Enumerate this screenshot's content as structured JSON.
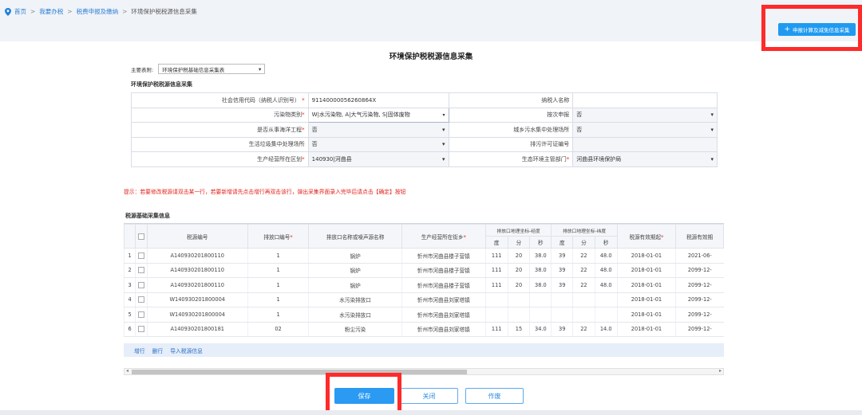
{
  "breadcrumb": {
    "items": [
      "首页",
      "我要办税",
      "税费申报及缴纳",
      "环境保护税税源信息采集"
    ],
    "separator": ">"
  },
  "top_button": {
    "label": "申报计算及减免信息采集",
    "icon": "plus-icon"
  },
  "form": {
    "title": "环境保护税税源信息采集",
    "main_table_label": "主要表附:",
    "main_table_value": "环境保护税基础信息采集表",
    "section_title": "环境保护税税源信息采集",
    "fields": {
      "credit_code_label": "社会信用代码（纳税人识别号）",
      "credit_code_value": "91140000056260864X",
      "taxpayer_name_label": "纳税人名称",
      "taxpayer_name_value": "",
      "pollutant_label": "污染物类别",
      "pollutant_value": "W|水污染物, A|大气污染物, S|固体废物",
      "per_time_label": "按次申报",
      "per_time_value": "否",
      "marine_label": "是否从事海洋工程",
      "marine_value": "否",
      "sewage_label": "城乡污水集中处理场所",
      "sewage_value": "否",
      "garbage_label": "生活垃圾集中处理场所",
      "garbage_value": "否",
      "permit_label": "排污许可证编号",
      "permit_value": "",
      "district_label": "生产经营所在区划",
      "district_value": "140930|河曲县",
      "env_dept_label": "生态环境主管部门",
      "env_dept_value": "河曲县环境保护局"
    }
  },
  "tip": "提示：若要修改税源请双击某一行，若要新增请先点击增行再双击该行，弹出采集界面录入完毕后请点击【确定】按钮",
  "grid": {
    "title": "税源基础采集信息",
    "headers": {
      "source_no": "税源编号",
      "outlet_no": "排放口编号",
      "outlet_name": "排放口名称或噪声源名称",
      "location": "生产经营所在街乡",
      "longitude_group": "排放口地理坐标-经度",
      "latitude_group": "排放口地理坐标-纬度",
      "deg": "度",
      "min": "分",
      "sec": "秒",
      "valid_from": "税源有效期起",
      "valid_to": "税源有效期"
    },
    "rows": [
      {
        "n": "1",
        "source": "A140930201800110",
        "outlet": "1",
        "name": "锅炉",
        "loc": "忻州市河曲县楼子营镇",
        "lo_d": "111",
        "lo_m": "20",
        "lo_s": "38.0",
        "la_d": "39",
        "la_m": "22",
        "la_s": "48.0",
        "from": "2018-01-01",
        "to": "2021-06-"
      },
      {
        "n": "2",
        "source": "A140930201800110",
        "outlet": "1",
        "name": "锅炉",
        "loc": "忻州市河曲县楼子营镇",
        "lo_d": "111",
        "lo_m": "20",
        "lo_s": "38.0",
        "la_d": "39",
        "la_m": "22",
        "la_s": "48.0",
        "from": "2018-01-01",
        "to": "2099-12-"
      },
      {
        "n": "3",
        "source": "A140930201800110",
        "outlet": "1",
        "name": "锅炉",
        "loc": "忻州市河曲县楼子营镇",
        "lo_d": "111",
        "lo_m": "20",
        "lo_s": "38.0",
        "la_d": "39",
        "la_m": "22",
        "la_s": "48.0",
        "from": "2018-01-01",
        "to": "2099-12-"
      },
      {
        "n": "4",
        "source": "W140930201800004",
        "outlet": "1",
        "name": "水污染排放口",
        "loc": "忻州市河曲县刘家塔镇",
        "lo_d": "",
        "lo_m": "",
        "lo_s": "",
        "la_d": "",
        "la_m": "",
        "la_s": "",
        "from": "2018-01-01",
        "to": "2099-12-"
      },
      {
        "n": "5",
        "source": "W140930201800004",
        "outlet": "1",
        "name": "水污染排放口",
        "loc": "忻州市河曲县刘家塔镇",
        "lo_d": "",
        "lo_m": "",
        "lo_s": "",
        "la_d": "",
        "la_m": "",
        "la_s": "",
        "from": "2018-01-01",
        "to": "2099-12-"
      },
      {
        "n": "6",
        "source": "A140930201800181",
        "outlet": "02",
        "name": "粉尘污染",
        "loc": "忻州市河曲县刘家塔镇",
        "lo_d": "111",
        "lo_m": "15",
        "lo_s": "34.0",
        "la_d": "39",
        "la_m": "22",
        "la_s": "14.0",
        "from": "2018-01-01",
        "to": "2099-12-"
      }
    ],
    "footer_links": [
      "增行",
      "删行",
      "导入税源信息"
    ]
  },
  "buttons": {
    "save": "保存",
    "close": "关闭",
    "void": "作废"
  },
  "colors": {
    "primary": "#2a9af3",
    "highlight_red": "#ff2a2a",
    "link": "#2a7fd4",
    "tip_red": "#e2231a"
  }
}
